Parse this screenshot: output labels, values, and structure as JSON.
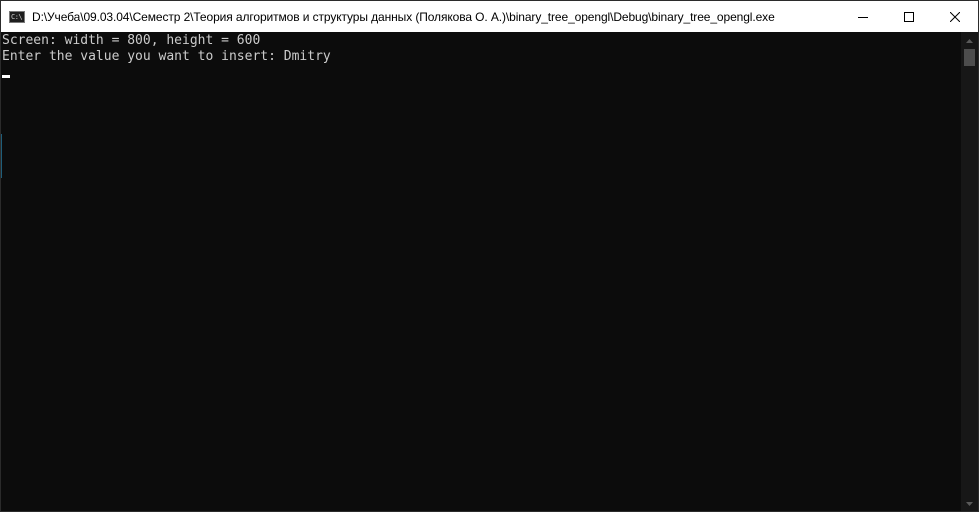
{
  "window": {
    "title": "D:\\Учеба\\09.03.04\\Семестр 2\\Теория алгоритмов и структуры данных (Полякова О. А.)\\binary_tree_opengl\\Debug\\binary_tree_opengl.exe",
    "icon_glyph": "C:\\",
    "icon": "console-app-icon",
    "controls": {
      "minimize": "minimize-icon",
      "maximize": "maximize-icon",
      "close": "close-icon"
    }
  },
  "console": {
    "lines": [
      "Screen: width = 800, height = 600",
      "Enter the value you want to insert: Dmitry"
    ],
    "text_color": "#cccccc",
    "background": "#0c0c0c"
  },
  "scrollbar": {
    "up_icon": "scroll-up-arrow-icon",
    "down_icon": "scroll-down-arrow-icon"
  }
}
